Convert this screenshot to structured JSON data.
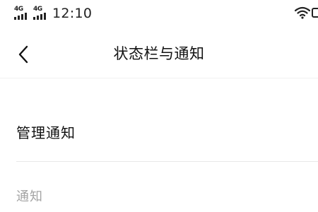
{
  "status_bar": {
    "network_1": "4G",
    "network_2": "4G",
    "time": "12:10",
    "icons": [
      "signal-bars-icon",
      "signal-bars-icon",
      "wifi-icon",
      "battery-icon"
    ]
  },
  "nav": {
    "back_icon": "chevron-left-icon",
    "title": "状态栏与通知"
  },
  "list": {
    "manage_notifications_label": "管理通知",
    "section_header": "通知"
  },
  "colors": {
    "background": "#ffffff",
    "text_primary": "#111111",
    "text_secondary": "#a4a4a4",
    "divider": "#e8e8e8"
  }
}
